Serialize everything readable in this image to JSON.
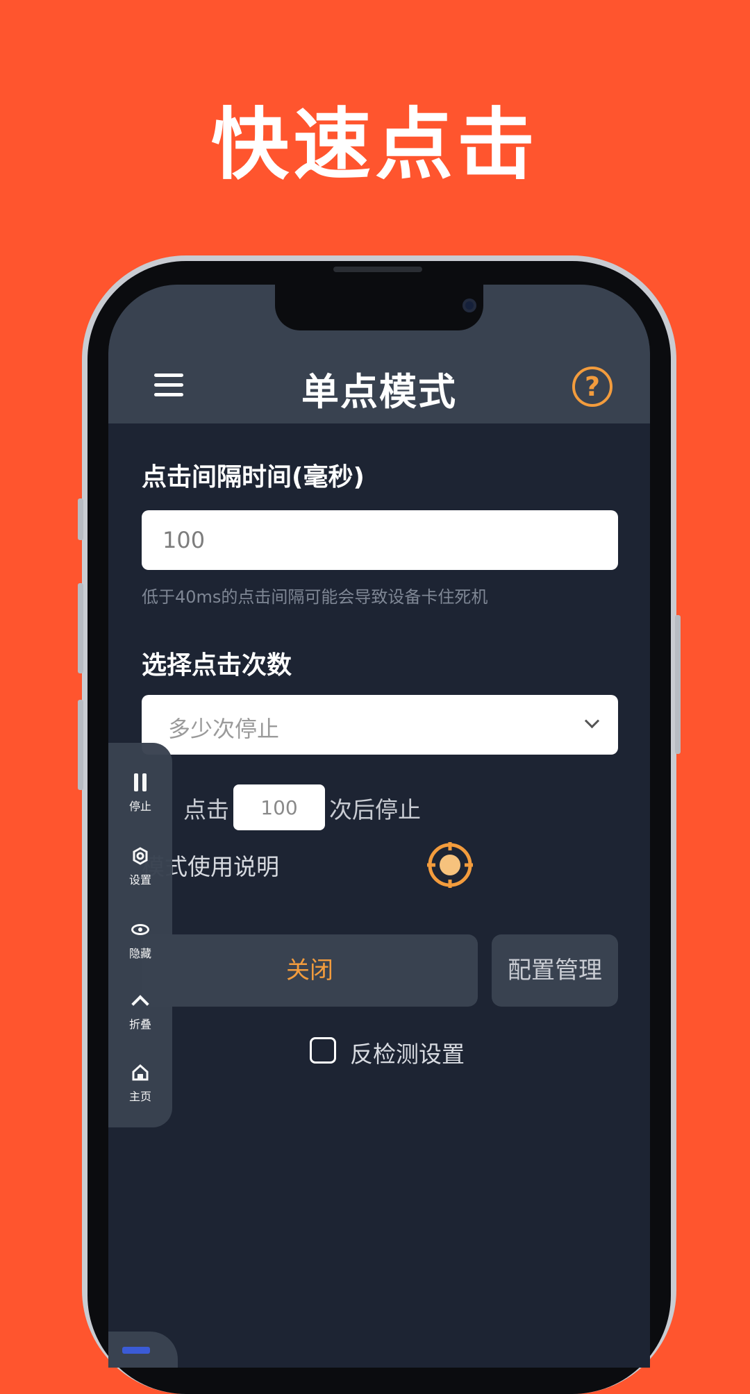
{
  "promo": {
    "title": "快速点击"
  },
  "appbar": {
    "title": "单点模式",
    "help_icon": "question-circle-icon",
    "menu_icon": "hamburger-menu-icon"
  },
  "interval": {
    "label": "点击间隔时间(毫秒)",
    "value": "100",
    "hint": "低于40ms的点击间隔可能会导致设备卡住死机"
  },
  "count": {
    "label": "选择点击次数",
    "select_value": "多少次停止",
    "prefix": "点击",
    "input_value": "100",
    "suffix": "次后停止"
  },
  "instructions": {
    "label": "模式使用说明"
  },
  "buttons": {
    "close": "关闭",
    "config": "配置管理"
  },
  "anti_detect": {
    "label": "反检测设置",
    "checked": false
  },
  "toolbar": {
    "items": [
      {
        "label": "停止",
        "icon": "pause-icon"
      },
      {
        "label": "设置",
        "icon": "gear-icon"
      },
      {
        "label": "隐藏",
        "icon": "eye-icon"
      },
      {
        "label": "折叠",
        "icon": "chevron-up-icon"
      },
      {
        "label": "主页",
        "icon": "home-icon"
      }
    ]
  },
  "colors": {
    "background": "#FF552E",
    "screen": "#1d2433",
    "panel": "#394250",
    "accent": "#F39C3D"
  }
}
